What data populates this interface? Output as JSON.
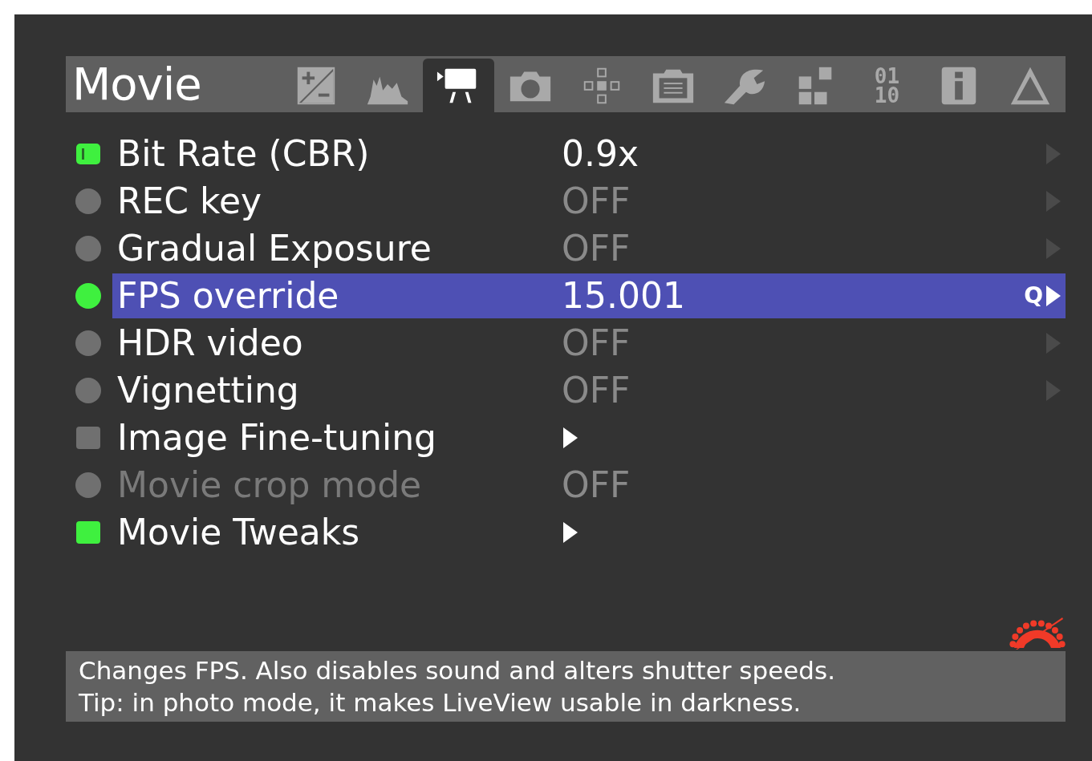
{
  "header": {
    "title": "Movie",
    "tabs": [
      {
        "kind": "exposure",
        "selected": false
      },
      {
        "kind": "histogram",
        "selected": false
      },
      {
        "kind": "movie",
        "selected": true
      },
      {
        "kind": "camera",
        "selected": false
      },
      {
        "kind": "focus",
        "selected": false
      },
      {
        "kind": "clipboard",
        "selected": false
      },
      {
        "kind": "wrench",
        "selected": false
      },
      {
        "kind": "squares",
        "selected": false
      },
      {
        "kind": "binary",
        "lines": [
          "01",
          "10"
        ],
        "selected": false
      },
      {
        "kind": "info",
        "selected": false
      },
      {
        "kind": "triangle",
        "selected": false
      }
    ]
  },
  "rows": [
    {
      "label": "Bit Rate (CBR)",
      "value": "0.9x",
      "kind": "gauge",
      "active": true,
      "disabled": false,
      "value_on": true,
      "arrow": true,
      "submenu": false,
      "selected": false
    },
    {
      "label": "REC key",
      "value": "OFF",
      "kind": "circle",
      "active": false,
      "disabled": false,
      "value_on": false,
      "arrow": true,
      "submenu": false,
      "selected": false
    },
    {
      "label": "Gradual Exposure",
      "value": "OFF",
      "kind": "circle",
      "active": false,
      "disabled": false,
      "value_on": false,
      "arrow": true,
      "submenu": false,
      "selected": false
    },
    {
      "label": "FPS override",
      "value": "15.001",
      "kind": "circle",
      "active": true,
      "disabled": false,
      "value_on": true,
      "arrow": true,
      "submenu": false,
      "selected": true,
      "quick": "Q"
    },
    {
      "label": "HDR video",
      "value": "OFF",
      "kind": "circle",
      "active": false,
      "disabled": false,
      "value_on": false,
      "arrow": true,
      "submenu": false,
      "selected": false
    },
    {
      "label": "Vignetting",
      "value": "OFF",
      "kind": "circle",
      "active": false,
      "disabled": false,
      "value_on": false,
      "arrow": true,
      "submenu": false,
      "selected": false
    },
    {
      "label": "Image Fine-tuning",
      "kind": "square",
      "active": false,
      "disabled": false,
      "arrow": false,
      "submenu": true,
      "selected": false
    },
    {
      "label": "Movie crop mode",
      "value": "OFF",
      "kind": "circle",
      "active": false,
      "disabled": true,
      "value_on": false,
      "arrow": false,
      "submenu": false,
      "selected": false
    },
    {
      "label": "Movie Tweaks",
      "kind": "square",
      "active": true,
      "disabled": false,
      "arrow": false,
      "submenu": true,
      "selected": false
    }
  ],
  "help": [
    "Changes FPS. Also disables sound and alters shutter speeds.",
    "Tip: in photo mode, it makes LiveView usable in darkness."
  ]
}
